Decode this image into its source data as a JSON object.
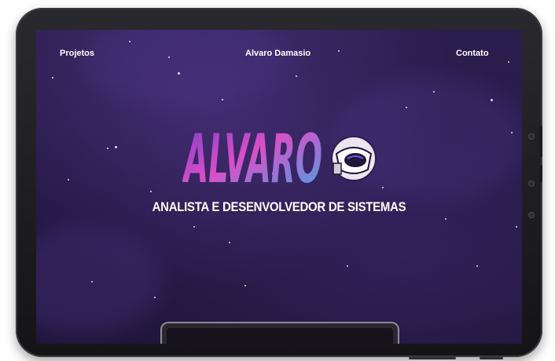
{
  "nav": {
    "left_link": "Projetos",
    "center_title": "Alvaro Damasio",
    "right_link": "Contato"
  },
  "hero": {
    "logo_text": "ALVARO",
    "subtitle": "ANALISTA E DESENVOLVEDOR DE SISTEMAS"
  },
  "colors": {
    "background": "#241844",
    "logo_gradient_start": "#7a3fc8",
    "logo_gradient_mid": "#d94fc7",
    "logo_gradient_end": "#3fa8e8",
    "text": "#ffffff"
  },
  "icons": [
    "astronaut-helmet-icon"
  ]
}
